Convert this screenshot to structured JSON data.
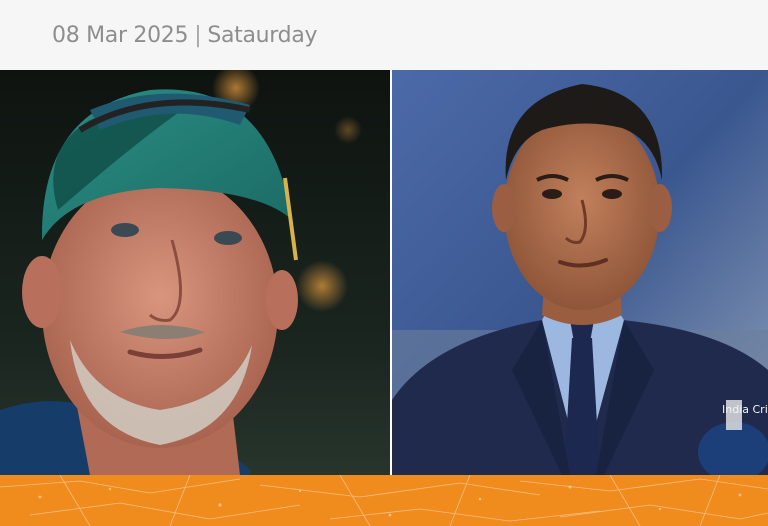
{
  "header": {
    "date": "08 Mar 2025",
    "separator": "|",
    "weekday": "Sataurday"
  },
  "photos": [
    {
      "subject": "coach-portrait",
      "side": "left"
    },
    {
      "subject": "commentator-portrait",
      "side": "right",
      "jacket_text": "India Cric"
    }
  ],
  "colors": {
    "footer_orange": "#f08c1e",
    "date_text": "#8e8e8e",
    "date_bar_bg": "#f6f6f6"
  }
}
